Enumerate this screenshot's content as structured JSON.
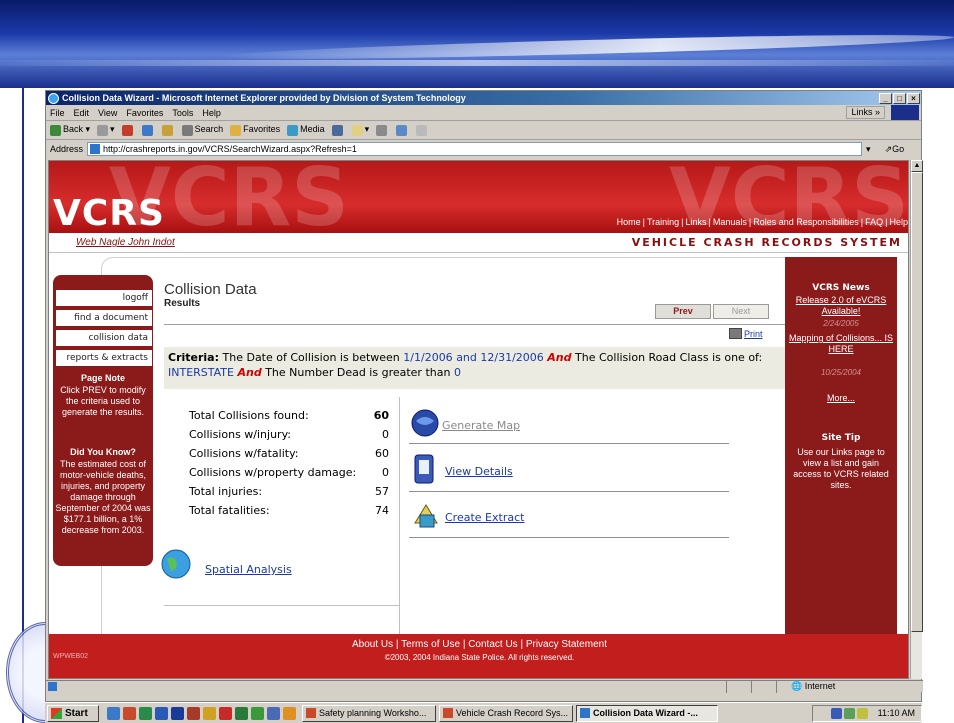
{
  "window": {
    "title": "Collision Data Wizard - Microsoft Internet Explorer provided by Division of System Technology",
    "controls": [
      "_",
      "□",
      "×"
    ]
  },
  "menu": {
    "items": [
      "File",
      "Edit",
      "View",
      "Favorites",
      "Tools",
      "Help"
    ],
    "links": "Links »"
  },
  "toolbar": {
    "back": "Back",
    "search": "Search",
    "favorites": "Favorites",
    "media": "Media"
  },
  "address": {
    "label": "Address",
    "url": "http://crashreports.in.gov/VCRS/SearchWizard.aspx?Refresh=1",
    "go": "Go"
  },
  "site": {
    "logo": "VCRS",
    "top_links": [
      "Home",
      "Training",
      "Links",
      "Manuals",
      "Roles and Responsibilities",
      "FAQ",
      "Help"
    ],
    "user": "Web Nagle John Indot",
    "tagline": "VEHICLE CRASH RECORDS SYSTEM"
  },
  "left_nav": {
    "buttons": [
      "logoff",
      "find a document",
      "collision data",
      "reports & extracts"
    ],
    "page_note_title": "Page Note",
    "page_note": "Click PREV to modify the criteria used to generate the results.",
    "did_you_know_title": "Did You Know?",
    "did_you_know": "The estimated cost of motor-vehicle deaths, injuries, and property damage through September of 2004 was $177.1 billion, a 1% decrease from 2003."
  },
  "main": {
    "title": "Collision Data",
    "subtitle": "Results",
    "prev": "Prev",
    "next": "Next",
    "print": "Print",
    "criteria": {
      "label": "Criteria:",
      "t1": "The Date of Collision is between",
      "d1": "1/1/2006",
      "t2": "and",
      "d2": "12/31/2006",
      "and1": "And",
      "t3": "The Collision Road Class is one of:",
      "v1": "INTERSTATE",
      "and2": "And",
      "t4": "The Number Dead is greater than",
      "v2": "0"
    },
    "stats": [
      {
        "label": "Total Collisions found:",
        "value": "60"
      },
      {
        "label": "Collisions w/injury:",
        "value": "0"
      },
      {
        "label": "Collisions w/fatality:",
        "value": "60"
      },
      {
        "label": "Collisions w/property damage:",
        "value": "0"
      },
      {
        "label": "Total injuries:",
        "value": "57"
      },
      {
        "label": "Total fatalities:",
        "value": "74"
      }
    ],
    "actions": {
      "generate_map": "Generate Map",
      "view_details": "View Details",
      "create_extract": "Create Extract",
      "spatial_analysis": "Spatial Analysis"
    }
  },
  "right_nav": {
    "news_title": "VCRS News",
    "news1": "Release 2.0 of eVCRS Available!",
    "news1_date": "2/24/2005",
    "news2": "Mapping of Collisions... IS HERE",
    "news2_date": "10/25/2004",
    "more": "More...",
    "tip_title": "Site Tip",
    "tip": "Use our Links page to view a list and gain access to VCRS related sites."
  },
  "footer": {
    "links": [
      "About Us",
      "Terms of Use",
      "Contact Us",
      "Privacy Statement"
    ],
    "copyright": "©2003, 2004 Indiana State Police. All rights reserved.",
    "code": "WPWEB02"
  },
  "status": {
    "zone": "Internet"
  },
  "taskbar": {
    "start": "Start",
    "tasks": [
      "Safety planning Worksho...",
      "Vehicle Crash Record Sys...",
      "Collision Data Wizard -..."
    ],
    "clock": "11:10 AM"
  },
  "colors": {
    "vcrs_red": "#c21e1e",
    "nav_maroon": "#8b1a1a",
    "link_blue": "#1a3aa8",
    "criteria_and": "#d00000"
  }
}
